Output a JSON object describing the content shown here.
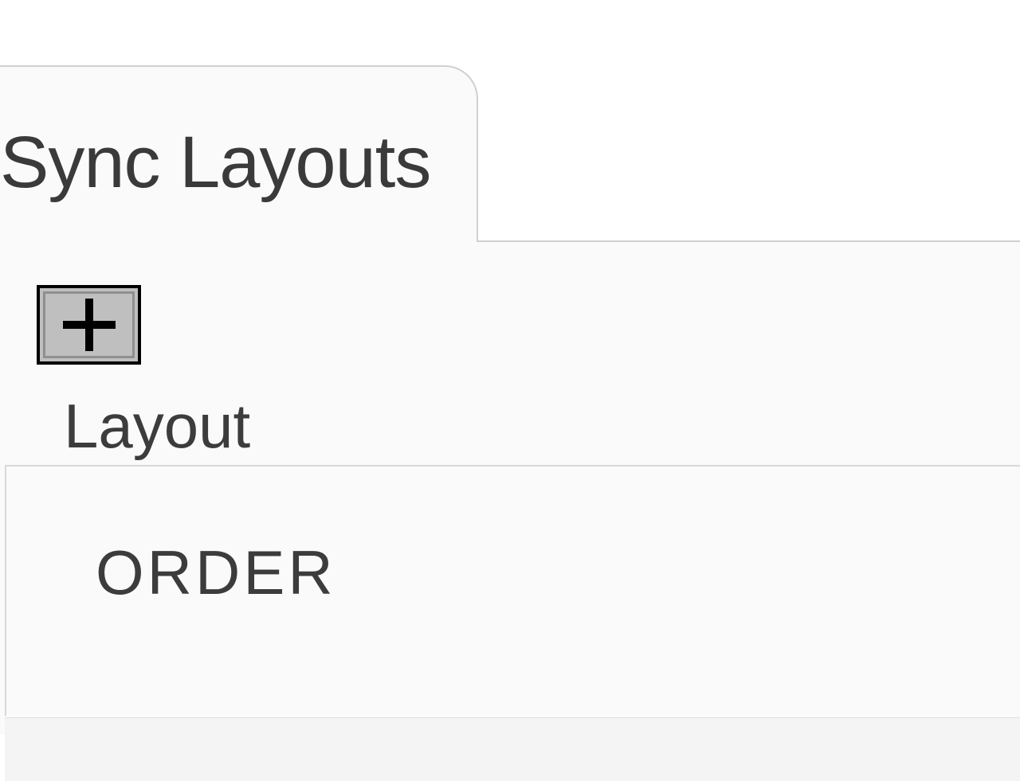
{
  "tab": {
    "label": "Sync Layouts"
  },
  "toolbar": {
    "layout_label": "Layout"
  },
  "list": {
    "header": "ORDER"
  }
}
